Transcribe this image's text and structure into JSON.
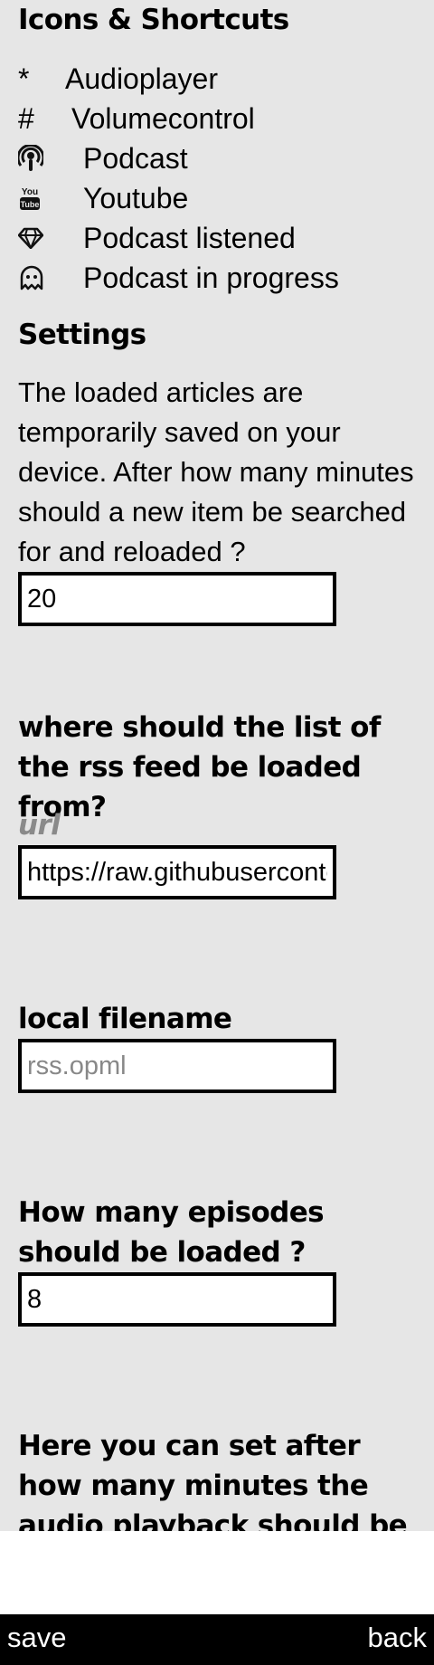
{
  "icons_section": {
    "title": "Icons & Shortcuts",
    "items": [
      {
        "symbol": "*",
        "label": "Audioplayer"
      },
      {
        "symbol": "#",
        "label": "Volumecontrol"
      },
      {
        "icon": "podcast-icon",
        "label": "Podcast"
      },
      {
        "icon": "youtube-icon",
        "label": "Youtube"
      },
      {
        "icon": "diamond-icon",
        "label": "Podcast listened"
      },
      {
        "icon": "ghost-icon",
        "label": "Podcast in progress"
      }
    ]
  },
  "settings": {
    "title": "Settings",
    "reload_text": "The loaded articles are temporarily saved on your device. After how many minutes should a new item be searched for and reloaded ?",
    "reload_value": "20",
    "rss_source_label": "where should the list of the rss feed be loaded from?",
    "url_label": "url",
    "url_value": "https://raw.githubusercontent.com",
    "local_filename_label": "local filename",
    "local_filename_placeholder": "rss.opml",
    "episodes_label": "How many episodes should be loaded ?",
    "episodes_value": "8",
    "sleep_label": "Here you can set after how many minutes the audio playback should be stopped"
  },
  "footer": {
    "save_label": "save",
    "back_label": "back"
  }
}
